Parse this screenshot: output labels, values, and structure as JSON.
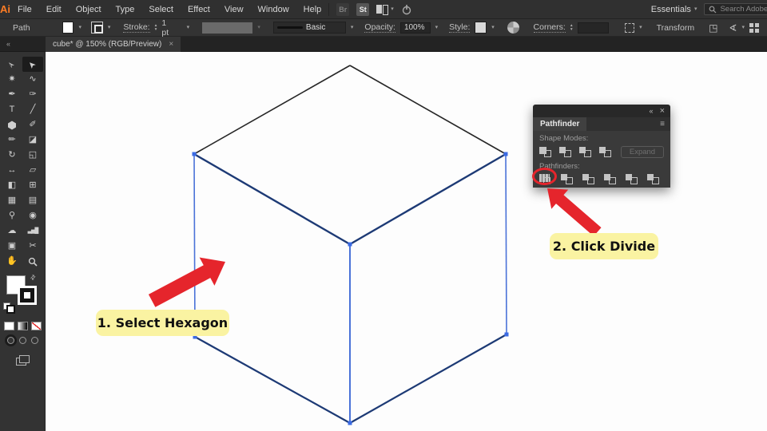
{
  "menubar": {
    "logo": "Ai",
    "items": [
      "File",
      "Edit",
      "Object",
      "Type",
      "Select",
      "Effect",
      "View",
      "Window",
      "Help"
    ],
    "bridge_label": "Br",
    "stock_label": "St",
    "workspace_label": "Essentials",
    "search_placeholder": "Search Adobe Stock"
  },
  "controlbar": {
    "selection_label": "Path",
    "stroke_label": "Stroke:",
    "stroke_weight": "1 pt",
    "brush_name": "Basic",
    "opacity_label": "Opacity:",
    "opacity_value": "100%",
    "style_label": "Style:",
    "corners_label": "Corners:",
    "transform_label": "Transform",
    "align_icon": "◳",
    "shear_icon": "∢"
  },
  "document_tab": {
    "title": "cube* @ 150% (RGB/Preview)",
    "close": "×"
  },
  "toolbar": {
    "tools": [
      {
        "name": "selection",
        "glyph": "➢"
      },
      {
        "name": "direct-selection",
        "glyph": "➤"
      },
      {
        "name": "magic-wand",
        "glyph": "✷"
      },
      {
        "name": "lasso",
        "glyph": "∿"
      },
      {
        "name": "pen",
        "glyph": "✒"
      },
      {
        "name": "curvature",
        "glyph": "✑"
      },
      {
        "name": "type",
        "glyph": "T"
      },
      {
        "name": "line-segment",
        "glyph": "╱"
      },
      {
        "name": "polygon",
        "glyph": ""
      },
      {
        "name": "paintbrush",
        "glyph": "✐"
      },
      {
        "name": "shaper",
        "glyph": "✏"
      },
      {
        "name": "eraser",
        "glyph": "◪"
      },
      {
        "name": "rotate",
        "glyph": "↻"
      },
      {
        "name": "scale",
        "glyph": "◱"
      },
      {
        "name": "width",
        "glyph": "↔"
      },
      {
        "name": "free-transform",
        "glyph": "▱"
      },
      {
        "name": "shape-builder",
        "glyph": "◧"
      },
      {
        "name": "perspective-grid",
        "glyph": "⊞"
      },
      {
        "name": "mesh",
        "glyph": "▦"
      },
      {
        "name": "gradient",
        "glyph": "▤"
      },
      {
        "name": "eyedropper",
        "glyph": "⚲"
      },
      {
        "name": "blend",
        "glyph": "◉"
      },
      {
        "name": "symbol-sprayer",
        "glyph": "☁"
      },
      {
        "name": "column-graph",
        "glyph": "▃▅█"
      },
      {
        "name": "artboard",
        "glyph": "▣"
      },
      {
        "name": "slice",
        "glyph": "✂"
      },
      {
        "name": "hand",
        "glyph": "✋"
      },
      {
        "name": "zoom",
        "glyph": ""
      }
    ]
  },
  "pathfinder": {
    "title": "Pathfinder",
    "shape_modes_label": "Shape Modes:",
    "expand_label": "Expand",
    "pathfinders_label": "Pathfinders:",
    "shape_mode_icons": [
      "unite-icon",
      "minus-front-icon",
      "intersect-icon",
      "exclude-icon"
    ],
    "pathfinder_icons": [
      "divide-icon",
      "trim-icon",
      "merge-icon",
      "crop-icon",
      "outline-icon",
      "minus-back-icon"
    ]
  },
  "annotations": {
    "step1": "1. Select Hexagon",
    "step2": "2. Click Divide"
  },
  "colors": {
    "arrow_red": "#e5252c",
    "label_yellow": "#faf3a2",
    "selection_blue": "#4a72d8",
    "edge_navy": "#1d3a75",
    "edge_black": "#262626"
  },
  "ui": {
    "chevron": "▾",
    "stepper_up": "▴",
    "stepper_down": "▾",
    "collapse": "«",
    "close": "×",
    "panel_menu": "≡",
    "swap": "⇄"
  }
}
